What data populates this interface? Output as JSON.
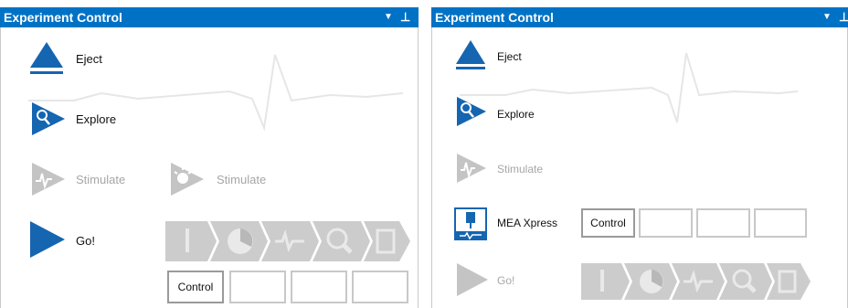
{
  "left_panel": {
    "title": "Experiment Control",
    "eject_label": "Eject",
    "explore_label": "Explore",
    "stimulate_label": "Stimulate",
    "stimulate2_label": "Stimulate",
    "go_label": "Go!",
    "control_label": "Control",
    "icons": [
      "eject-icon",
      "explore-icon",
      "stimulate-icon",
      "stimulate-bulb-icon",
      "go-icon"
    ]
  },
  "right_panel": {
    "title": "Experiment Control",
    "eject_label": "Eject",
    "explore_label": "Explore",
    "stimulate_label": "Stimulate",
    "mea_label": "MEA Xpress",
    "control_label": "Control",
    "go_label": "Go!",
    "icons": [
      "eject-icon",
      "explore-icon",
      "stimulate-icon",
      "mea-xpress-icon",
      "go-icon"
    ]
  },
  "colors": {
    "titlebar": "#0072c6",
    "accent": "#1565b0",
    "disabled": "#b5b5b5",
    "wave": "#e6e6e6"
  }
}
